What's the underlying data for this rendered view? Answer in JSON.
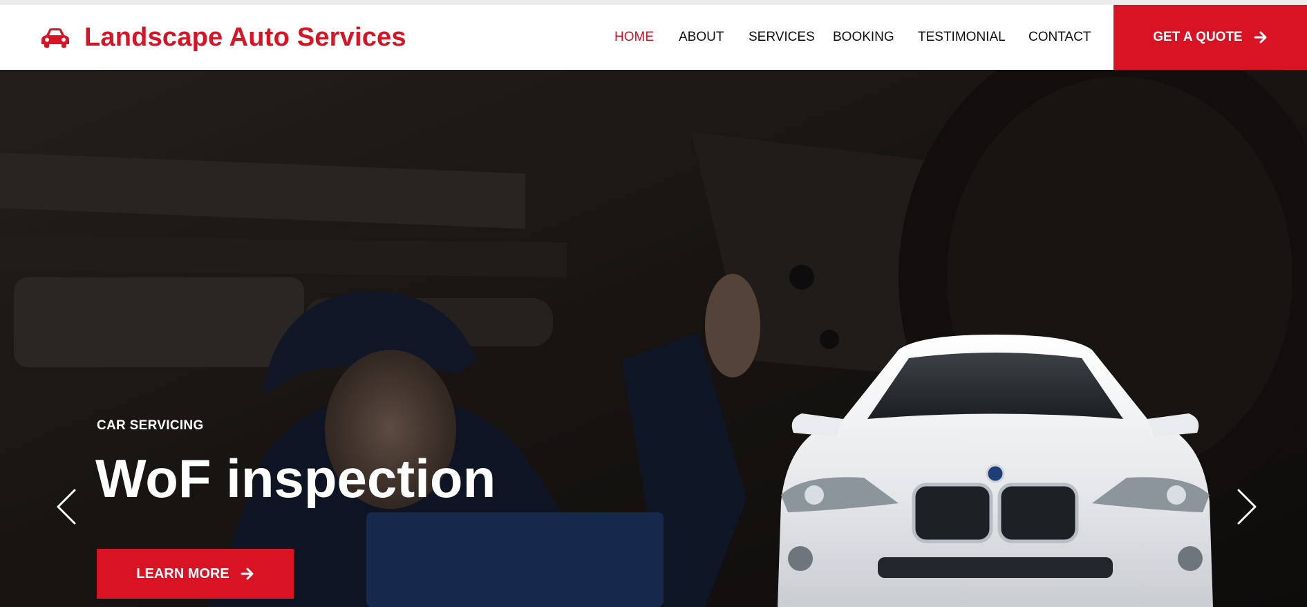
{
  "brand": {
    "name": "Landscape Auto Services",
    "icon": "car-icon"
  },
  "nav": {
    "items": [
      {
        "label": "HOME",
        "active": true
      },
      {
        "label": "ABOUT",
        "active": false
      },
      {
        "label": "SERVICES",
        "active": false
      },
      {
        "label": "BOOKING",
        "active": false
      },
      {
        "label": "TESTIMONIAL",
        "active": false
      },
      {
        "label": "CONTACT",
        "active": false
      }
    ],
    "cta": {
      "label": "GET A QUOTE",
      "icon": "arrow-right-icon"
    }
  },
  "hero": {
    "eyebrow": "CAR SERVICING",
    "title": "WoF inspection",
    "button": {
      "label": "LEARN MORE",
      "icon": "arrow-right-icon"
    },
    "prev_icon": "chevron-left-icon",
    "next_icon": "chevron-right-icon"
  },
  "colors": {
    "accent": "#d81324",
    "nav_text": "#111111",
    "white": "#ffffff"
  }
}
